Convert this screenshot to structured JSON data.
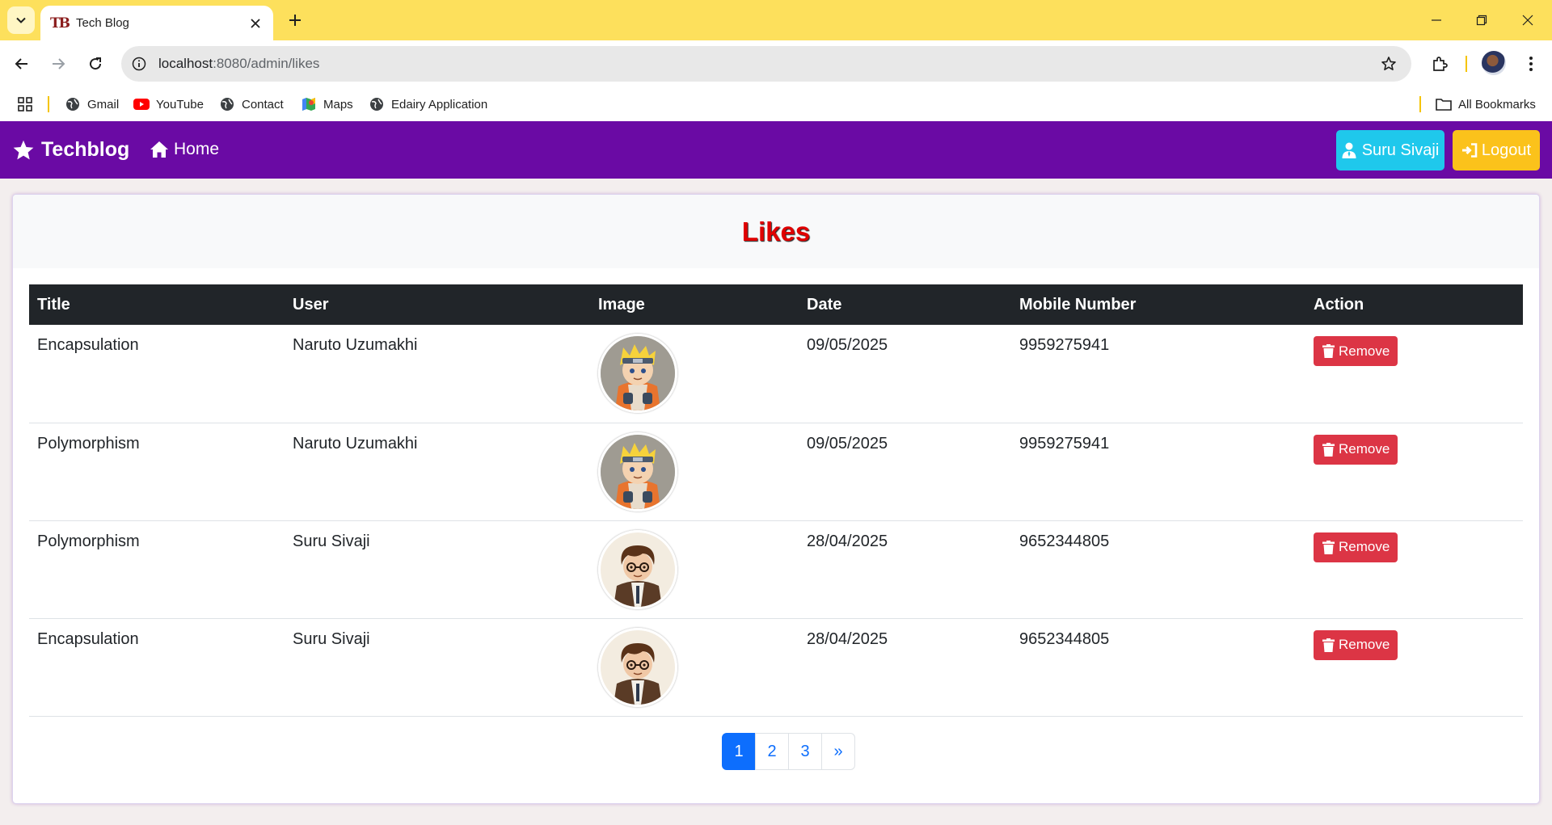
{
  "browser": {
    "tab_title": "Tech Blog",
    "favicon_text": "TB",
    "url_host": "localhost",
    "url_path": ":8080/admin/likes",
    "bookmarks": [
      {
        "label": "Gmail",
        "icon": "globe-icon"
      },
      {
        "label": "YouTube",
        "icon": "youtube-icon"
      },
      {
        "label": "Contact",
        "icon": "globe-icon"
      },
      {
        "label": "Maps",
        "icon": "maps-icon"
      },
      {
        "label": "Edairy Application",
        "icon": "globe-icon"
      }
    ],
    "all_bookmarks": "All Bookmarks"
  },
  "navbar": {
    "brand": "Techblog",
    "home": "Home",
    "user_button": "Suru Sivaji",
    "logout_button": "Logout",
    "colors": {
      "bg": "#6a0aa4",
      "user": "#1fc8ec",
      "logout": "#fbc21b"
    }
  },
  "page": {
    "title": "Likes",
    "columns": [
      "Title",
      "User",
      "Image",
      "Date",
      "Mobile Number",
      "Action"
    ],
    "rows": [
      {
        "title": "Encapsulation",
        "user": "Naruto Uzumakhi",
        "avatar": "naruto-avatar",
        "date": "09/05/2025",
        "mobile": "9959275941",
        "action": "Remove"
      },
      {
        "title": "Polymorphism",
        "user": "Naruto Uzumakhi",
        "avatar": "naruto-avatar",
        "date": "09/05/2025",
        "mobile": "9959275941",
        "action": "Remove"
      },
      {
        "title": "Polymorphism",
        "user": "Suru Sivaji",
        "avatar": "boy-avatar",
        "date": "28/04/2025",
        "mobile": "9652344805",
        "action": "Remove"
      },
      {
        "title": "Encapsulation",
        "user": "Suru Sivaji",
        "avatar": "boy-avatar",
        "date": "28/04/2025",
        "mobile": "9652344805",
        "action": "Remove"
      }
    ],
    "pagination": {
      "pages": [
        "1",
        "2",
        "3"
      ],
      "current": "1",
      "next": "»"
    }
  }
}
